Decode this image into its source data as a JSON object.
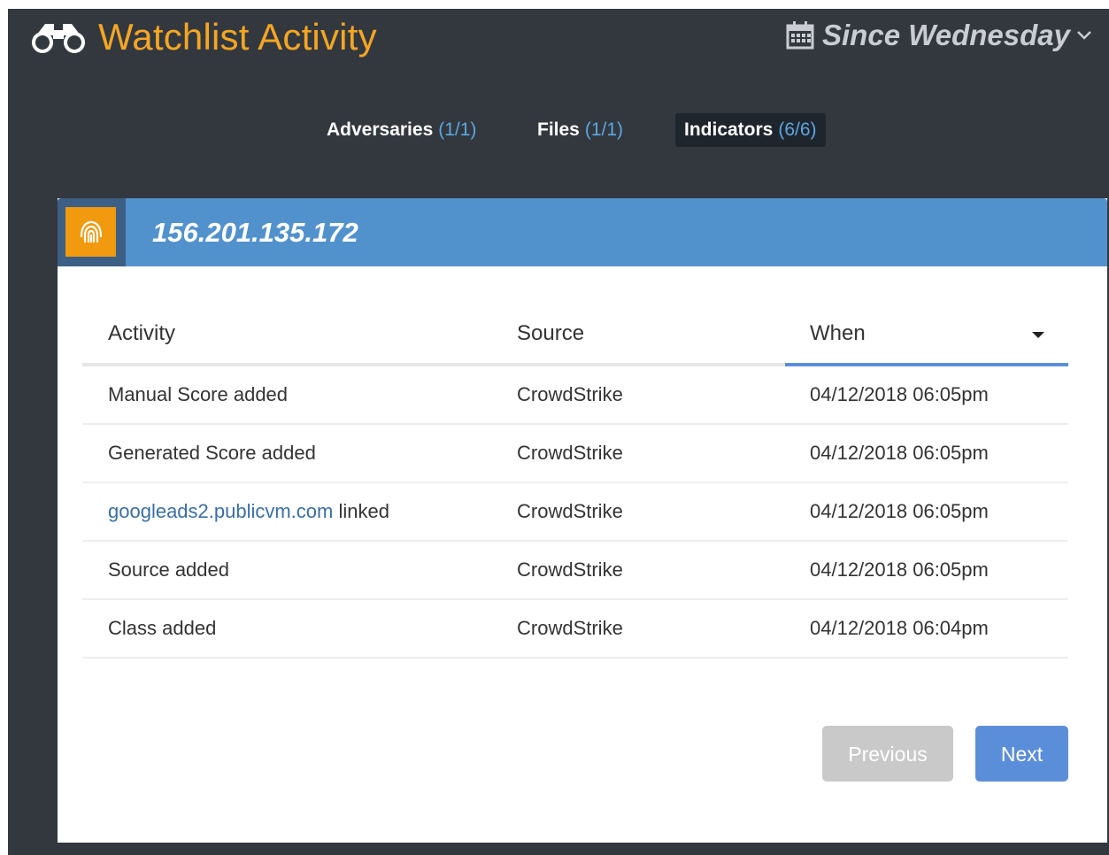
{
  "header": {
    "title": "Watchlist Activity",
    "date_filter": "Since Wednesday"
  },
  "tabs": [
    {
      "label": "Adversaries",
      "count": "(1/1)",
      "active": false
    },
    {
      "label": "Files",
      "count": "(1/1)",
      "active": false
    },
    {
      "label": "Indicators",
      "count": "(6/6)",
      "active": true
    }
  ],
  "card": {
    "indicator": "156.201.135.172",
    "indicator_icon": "fingerprint-icon"
  },
  "table": {
    "columns": [
      "Activity",
      "Source",
      "When"
    ],
    "sort_column": "When",
    "rows": [
      {
        "activity": "Manual Score added",
        "link": "",
        "suffix": "",
        "source": "CrowdStrike",
        "when": "04/12/2018 06:05pm"
      },
      {
        "activity": "Generated Score added",
        "link": "",
        "suffix": "",
        "source": "CrowdStrike",
        "when": "04/12/2018 06:05pm"
      },
      {
        "activity": "",
        "link": "googleads2.publicvm.com",
        "suffix": " linked",
        "source": "CrowdStrike",
        "when": "04/12/2018 06:05pm"
      },
      {
        "activity": "Source added",
        "link": "",
        "suffix": "",
        "source": "CrowdStrike",
        "when": "04/12/2018 06:05pm"
      },
      {
        "activity": "Class added",
        "link": "",
        "suffix": "",
        "source": "CrowdStrike",
        "when": "04/12/2018 06:04pm"
      }
    ]
  },
  "pagination": {
    "previous_label": "Previous",
    "next_label": "Next",
    "previous_disabled": true
  },
  "colors": {
    "background": "#33383f",
    "title_accent": "#f5a623",
    "card_header": "#5292cc",
    "indicator_badge": "#f29a0f",
    "link": "#3a6ea5",
    "primary_button": "#5b8ed8",
    "disabled_button": "#c9c9c9"
  }
}
